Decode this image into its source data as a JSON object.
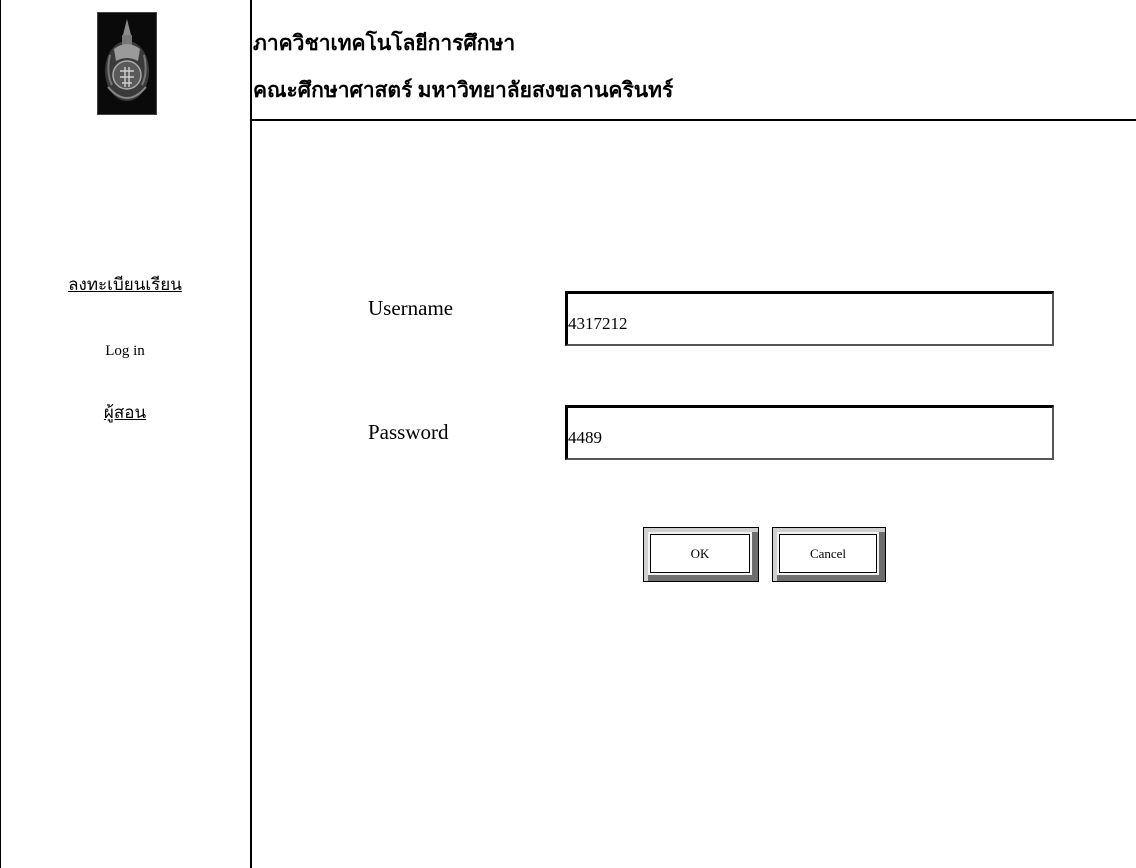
{
  "header": {
    "department": "ภาควิชาเทคโนโลยีการศึกษา",
    "faculty": "คณะศึกษาศาสตร์  มหาวิทยาลัยสงขลานครินทร์"
  },
  "sidebar": {
    "logo_icon": "university-emblem-icon",
    "items": [
      {
        "label": "ลงทะเบียนเรียน",
        "link": true
      },
      {
        "label": "Log in",
        "link": false
      },
      {
        "label": "ผู้สอน",
        "link": true
      }
    ]
  },
  "form": {
    "username_label": "Username",
    "username_value": "4317212",
    "password_label": "Password",
    "password_value": "4489",
    "ok_label": "OK",
    "cancel_label": "Cancel"
  }
}
